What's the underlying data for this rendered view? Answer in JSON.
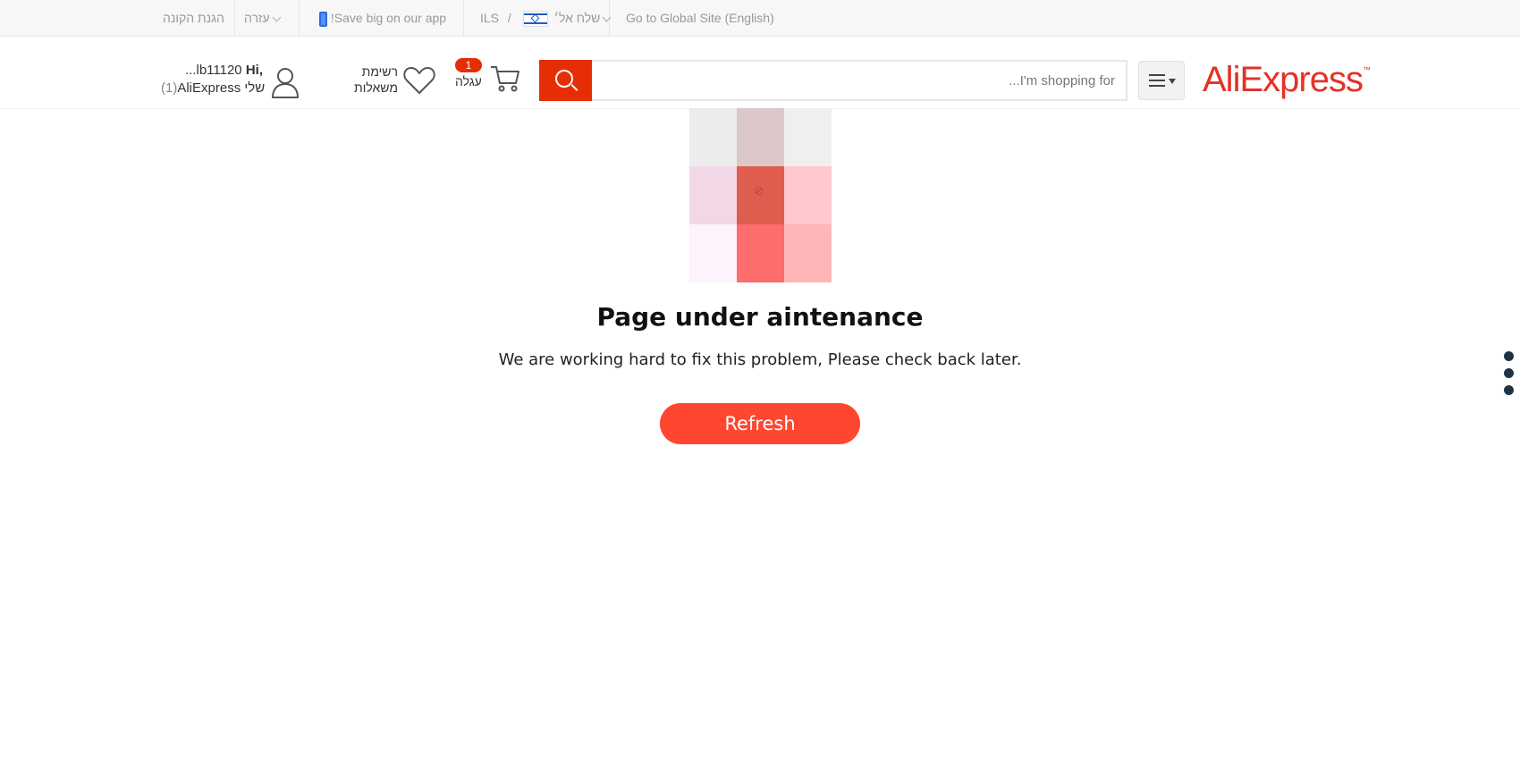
{
  "topbar": {
    "global_site": "Go to Global Site (English)",
    "ship_to": "שלח אל׳",
    "currency_sep": "/",
    "currency": "ILS",
    "app_promo": "!Save big on our app",
    "help": "עזרה",
    "buyer_protection": "הגנת הקונה"
  },
  "header": {
    "logo": "AliExpress",
    "logo_tm": "™",
    "search": {
      "placeholder": "I'm shopping for..."
    },
    "cart": {
      "count": "1",
      "label": "עגלה"
    },
    "wishlist": {
      "line1": "רשימת",
      "line2": "משאלות"
    },
    "account": {
      "greeting_name": "...lb11120",
      "greeting_hi": "Hi,",
      "line2_main": "AliExpress שלי",
      "line2_count": "(1)"
    }
  },
  "main": {
    "title": "Page under aintenance",
    "message": "We are working hard to fix this problem, Please check back later.",
    "refresh_label": "Refresh",
    "center_glyph": "⊘"
  },
  "colors": {
    "brand": "#e43225",
    "search_button": "#e62e04",
    "refresh_button": "#ff4630"
  },
  "icons": [
    "chevron-down-icon",
    "israel-flag-icon",
    "phone-icon",
    "menu-icon",
    "search-icon",
    "cart-icon",
    "heart-icon",
    "user-icon",
    "more-dots-icon"
  ]
}
